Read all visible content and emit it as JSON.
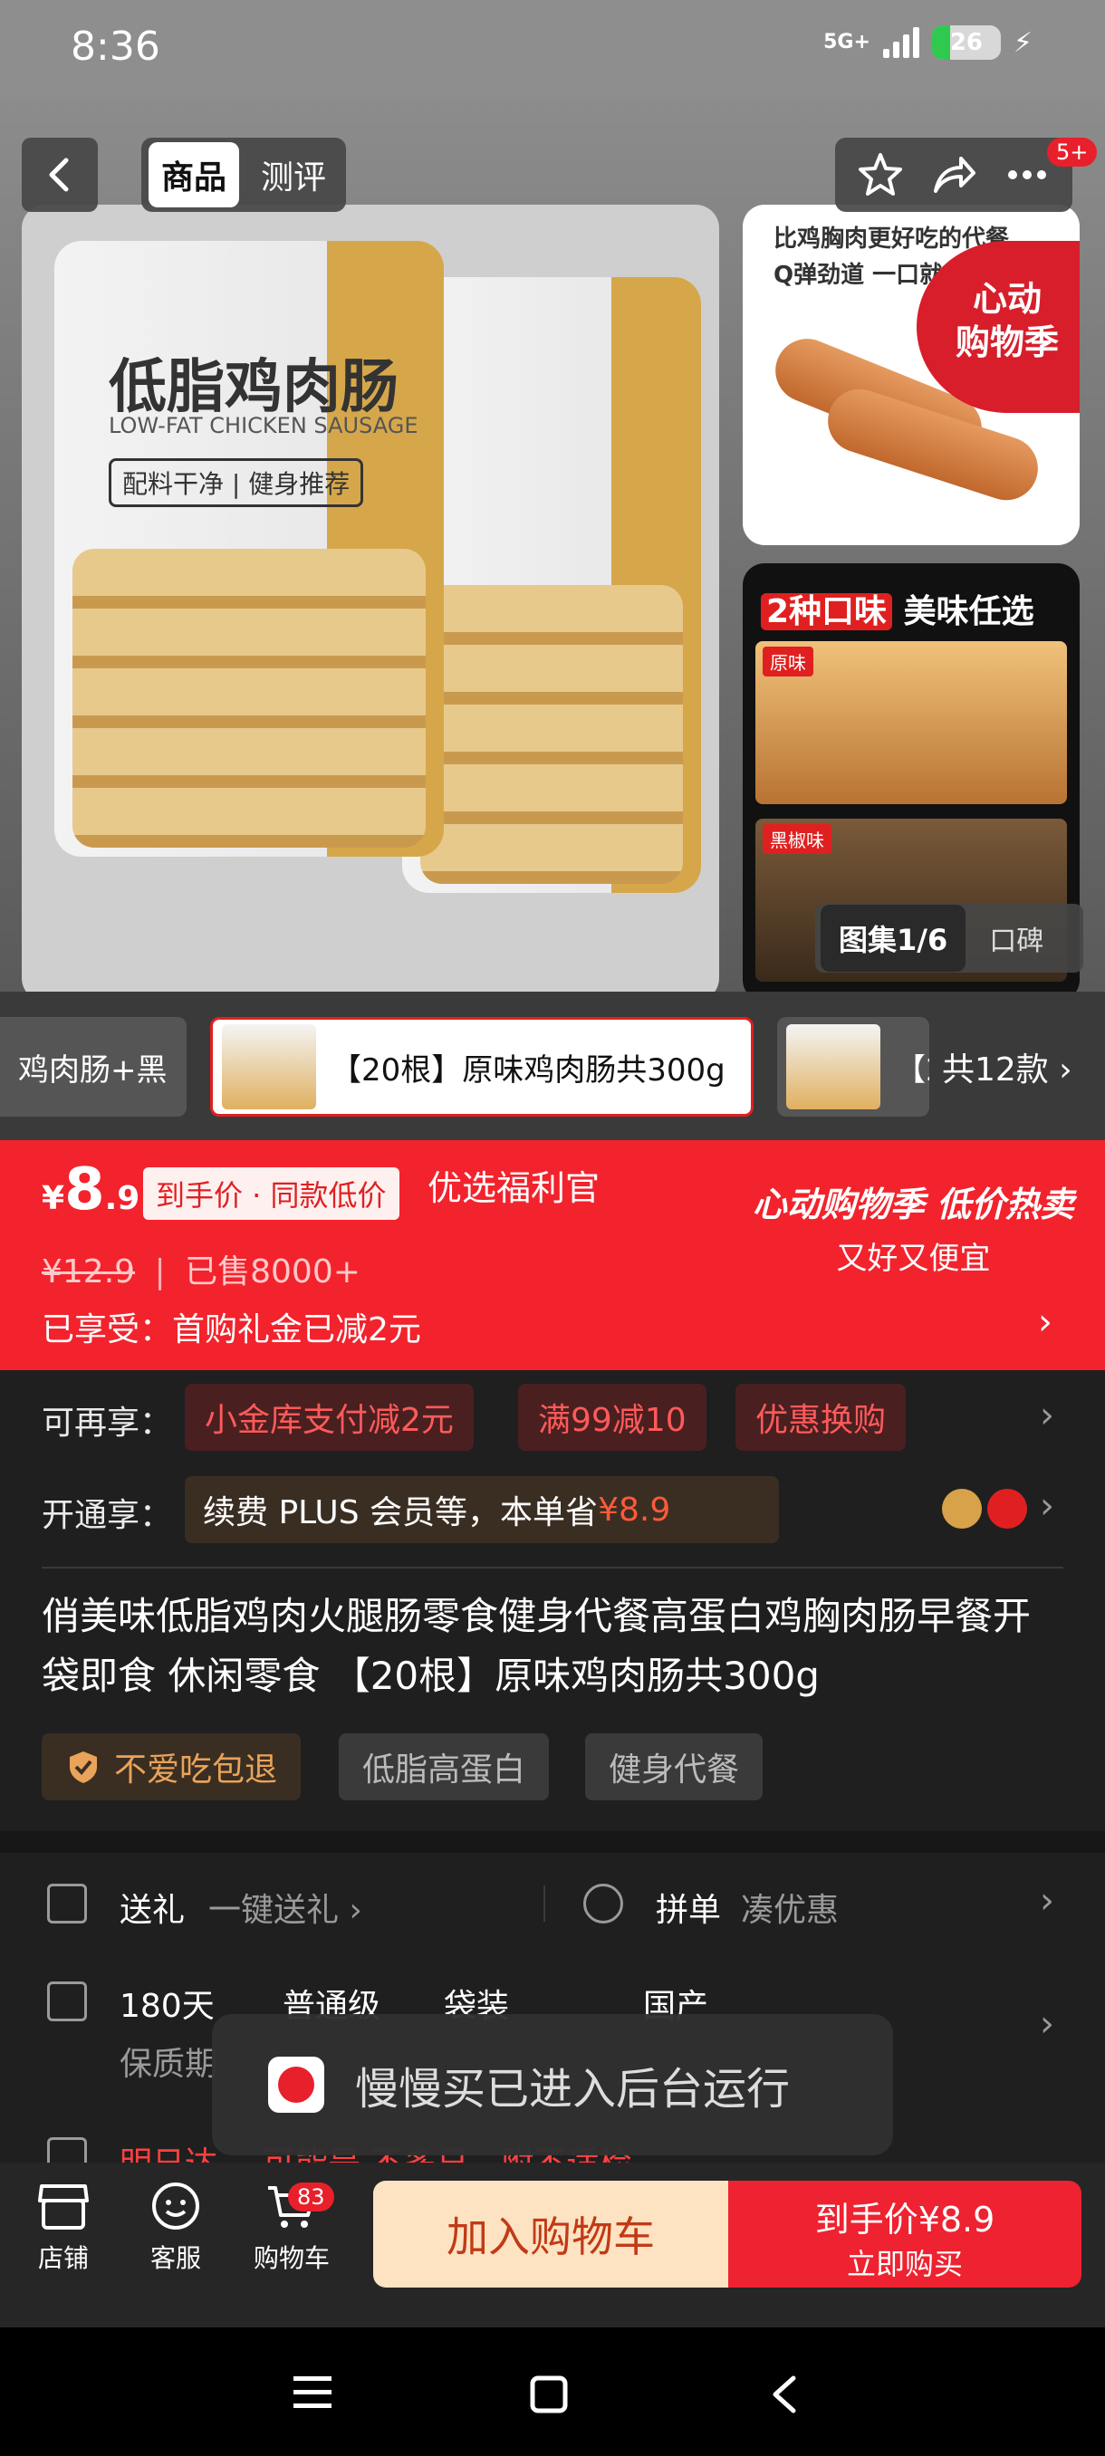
{
  "status_bar": {
    "time": "8:36",
    "signal": "5G+",
    "battery": "26"
  },
  "nav": {
    "tabs": [
      "商品",
      "测评"
    ],
    "notification_badge": "5+"
  },
  "gallery": {
    "bag_title": "低脂鸡肉肠",
    "bag_subtitle": "LOW-FAT CHICKEN SAUSAGE",
    "bag_tag": "配料干净 | 健身推荐",
    "side1_text": [
      "比鸡胸肉更好吃的代餐",
      "Q弹劲道 一口就"
    ],
    "side1_badge": [
      "心动",
      "购物季"
    ],
    "side2_header_red": "2种口味",
    "side2_header": "美味任选",
    "side2_labels": [
      "原味",
      "黑椒味"
    ],
    "counter": "图集1/6",
    "counter_other": "口碑"
  },
  "variants": {
    "items": [
      "鸡肉肠+黑",
      "【20根】原味鸡肉肠共300g",
      "【2"
    ],
    "total": "共12款 ›"
  },
  "price": {
    "yen": "¥",
    "integer": "8",
    "decimal": ".9",
    "tag": "到手价 · 同款低价",
    "seller": "优选福利官",
    "original": "¥12.9",
    "sold": "已售8000+",
    "promo_line1": "心动购物季 低价热卖",
    "promo_line2": "又好又便宜",
    "enjoyed": "已享受：首购礼金已减2元"
  },
  "offers": {
    "label": "可再享：",
    "coupons": [
      "小金库支付减2元",
      "满99减10",
      "优惠换购"
    ],
    "plus_label": "开通享：",
    "plus_text": "续费 PLUS 会员等，本单省",
    "plus_amount": "¥8.9"
  },
  "product": {
    "title": "俏美味低脂鸡肉火腿肠零食健身代餐高蛋白鸡胸肉肠早餐开袋即食 休闲零食 【20根】原味鸡肉肠共300g",
    "tags": [
      "不爱吃包退",
      "低脂高蛋白",
      "健身代餐"
    ]
  },
  "services": {
    "gift": "送礼",
    "gift_sub": "一键送礼 ›",
    "group": "拼单",
    "group_sub": "凑优惠",
    "specs": [
      "180天",
      "普通级",
      "袋装",
      "国产"
    ],
    "spec_sub": "保质期",
    "delivery": "明日达",
    "delivery_sub": "可能是 不多日，附不适检"
  },
  "toast": {
    "text": "慢慢买已进入后台运行"
  },
  "bottom_bar": {
    "store": "店铺",
    "service": "客服",
    "cart": "购物车",
    "cart_count": "83",
    "add_to_cart": "加入购物车",
    "buy_line1": "到手价¥8.9",
    "buy_line2": "立即购买"
  },
  "colors": {
    "accent": "#f2232d",
    "dark_bg": "#1f1f1f",
    "cart_btn": "#fde3c2"
  }
}
